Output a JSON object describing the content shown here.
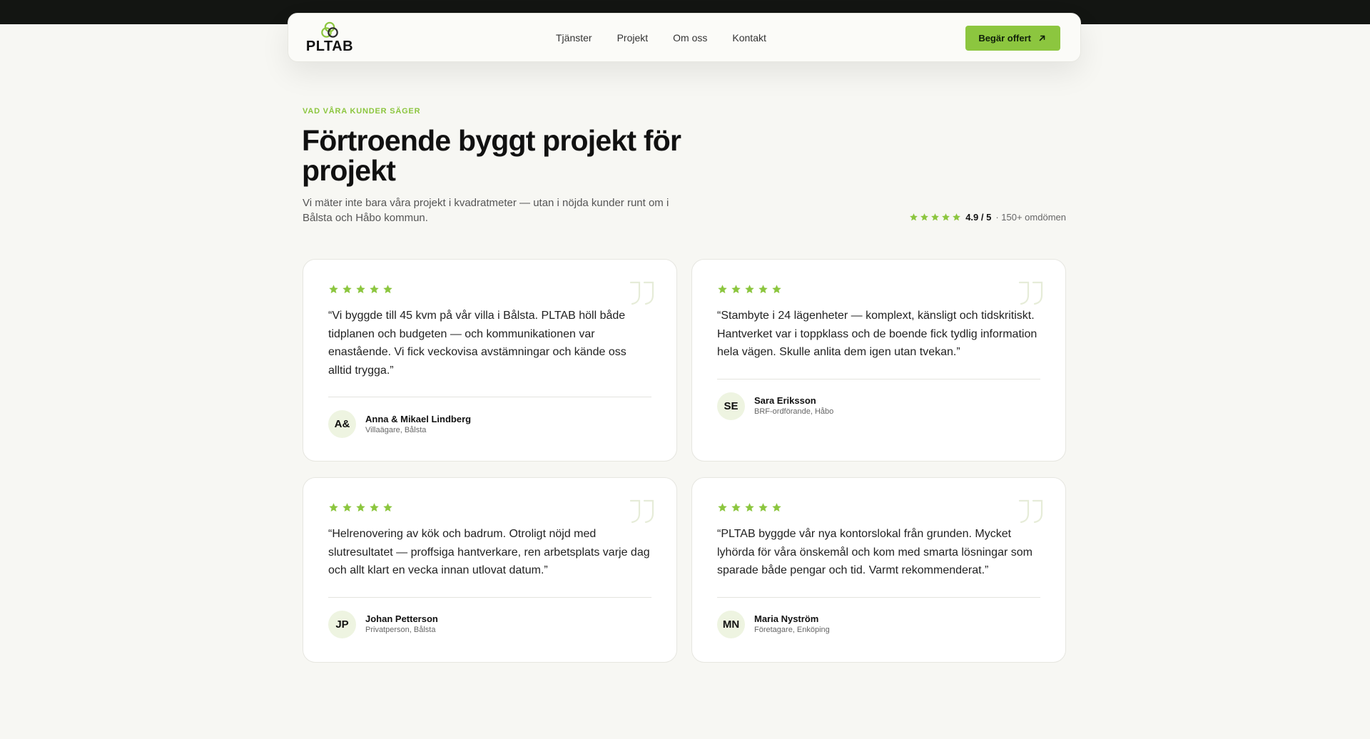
{
  "nav": {
    "logo_text": "PLTAB",
    "links": [
      "Tjänster",
      "Projekt",
      "Om oss",
      "Kontakt"
    ],
    "cta_label": "Begär offert"
  },
  "hero": {
    "eyebrow": "VAD VÅRA KUNDER SÄGER",
    "title": "Förtroende byggt projekt för projekt",
    "subtitle": "Vi mäter inte bara våra projekt i kvadratmeter — utan i nöjda kunder runt om i Bålsta och Håbo kommun."
  },
  "rating": {
    "stars": 5,
    "value": "4.9 / 5",
    "count": "· 150+ omdömen"
  },
  "testimonials": [
    {
      "stars": 5,
      "quote": "“Vi byggde till 45 kvm på vår villa i Bålsta. PLTAB höll både tidplanen och budgeten — och kommunikationen var enastående. Vi fick veckovisa avstämningar och kände oss alltid trygga.”",
      "initials": "A&",
      "name": "Anna & Mikael Lindberg",
      "role": "Villaägare, Bålsta"
    },
    {
      "stars": 5,
      "quote": "“Stambyte i 24 lägenheter — komplext, känsligt och tidskritiskt. Hantverket var i toppklass och de boende fick tydlig information hela vägen. Skulle anlita dem igen utan tvekan.”",
      "initials": "SE",
      "name": "Sara Eriksson",
      "role": "BRF-ordförande, Håbo"
    },
    {
      "stars": 5,
      "quote": "“Helrenovering av kök och badrum. Otroligt nöjd med slutresultatet — proffsiga hantverkare, ren arbetsplats varje dag och allt klart en vecka innan utlovat datum.”",
      "initials": "JP",
      "name": "Johan Petterson",
      "role": "Privatperson, Bålsta"
    },
    {
      "stars": 5,
      "quote": "“PLTAB byggde vår nya kontorslokal från grunden. Mycket lyhörda för våra önskemål och kom med smarta lösningar som sparade både pengar och tid. Varmt rekommenderat.”",
      "initials": "MN",
      "name": "Maria Nyström",
      "role": "Företagare, Enköping"
    }
  ],
  "colors": {
    "accent": "#8cc63f",
    "topbar": "#131512",
    "background": "#f7f7f3"
  }
}
